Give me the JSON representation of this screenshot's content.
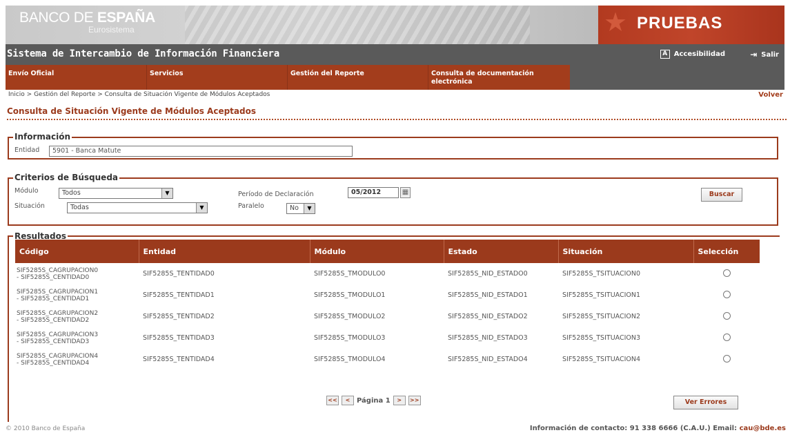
{
  "header": {
    "logo_banco": "BANCO DE ",
    "logo_espana": "ESPAÑA",
    "logo_sub": "Eurosistema",
    "environment_label": "PRUEBAS",
    "system_title": "Sistema de Intercambio de Información Financiera",
    "accessibility_label": "Accesibilidad",
    "exit_label": "Salir"
  },
  "nav": {
    "items": [
      {
        "label": "Envío Oficial"
      },
      {
        "label": "Servicios"
      },
      {
        "label": "Gestión del Reporte"
      },
      {
        "label": "Consulta de documentación electrónica"
      }
    ]
  },
  "breadcrumb": "Inicio > Gestión del Reporte > Consulta de Situación Vigente de Módulos Aceptados",
  "volver_label": "Volver",
  "page_title": "Consulta de Situación Vigente de Módulos Aceptados",
  "informacion": {
    "legend": "Información",
    "entidad_label": "Entidad",
    "entidad_value": "5901 - Banca Matute"
  },
  "criterios": {
    "legend": "Criterios de Búsqueda",
    "modulo_label": "Módulo",
    "modulo_value": "Todos",
    "situacion_label": "Situación",
    "situacion_value": "Todas",
    "periodo_label": "Período de Declaración",
    "periodo_value": "05/2012",
    "paralelo_label": "Paralelo",
    "paralelo_value": "No",
    "buscar_label": "Buscar"
  },
  "resultados": {
    "legend": "Resultados",
    "columns": [
      "Código",
      "Entidad",
      "Módulo",
      "Estado",
      "Situación",
      "Selección"
    ],
    "rows": [
      {
        "codigo1": "SIF5285S_CAGRUPACION0",
        "codigo2": "- SIF5285S_CENTIDAD0",
        "entidad": "SIF5285S_TENTIDAD0",
        "modulo": "SIF5285S_TMODULO0",
        "estado": "SIF5285S_NID_ESTADO0",
        "situacion": "SIF5285S_TSITUACION0"
      },
      {
        "codigo1": "SIF5285S_CAGRUPACION1",
        "codigo2": "- SIF5285S_CENTIDAD1",
        "entidad": "SIF5285S_TENTIDAD1",
        "modulo": "SIF5285S_TMODULO1",
        "estado": "SIF5285S_NID_ESTADO1",
        "situacion": "SIF5285S_TSITUACION1"
      },
      {
        "codigo1": "SIF5285S_CAGRUPACION2",
        "codigo2": "- SIF5285S_CENTIDAD2",
        "entidad": "SIF5285S_TENTIDAD2",
        "modulo": "SIF5285S_TMODULO2",
        "estado": "SIF5285S_NID_ESTADO2",
        "situacion": "SIF5285S_TSITUACION2"
      },
      {
        "codigo1": "SIF5285S_CAGRUPACION3",
        "codigo2": "- SIF5285S_CENTIDAD3",
        "entidad": "SIF5285S_TENTIDAD3",
        "modulo": "SIF5285S_TMODULO3",
        "estado": "SIF5285S_NID_ESTADO3",
        "situacion": "SIF5285S_TSITUACION3"
      },
      {
        "codigo1": "SIF5285S_CAGRUPACION4",
        "codigo2": "- SIF5285S_CENTIDAD4",
        "entidad": "SIF5285S_TENTIDAD4",
        "modulo": "SIF5285S_TMODULO4",
        "estado": "SIF5285S_NID_ESTADO4",
        "situacion": "SIF5285S_TSITUACION4"
      }
    ],
    "pager": {
      "first": "<<",
      "prev": "<",
      "page_text": "Página 1",
      "next": ">",
      "last": ">>"
    },
    "ver_errores_label": "Ver Errores"
  },
  "footer": {
    "copyright": "© 2010 Banco de España",
    "contact": "Información de contacto: 91 338 6666 (C.A.U.) Email: ",
    "email": "cau@bde.es"
  },
  "icons": {
    "accessibility": "A",
    "exit": "⇥",
    "calendar": "▦",
    "dropdown": "▼"
  },
  "colors": {
    "brand_red": "#9b3a1c",
    "nav_orange": "#a33d1c",
    "header_gray": "#5a5a5a"
  }
}
